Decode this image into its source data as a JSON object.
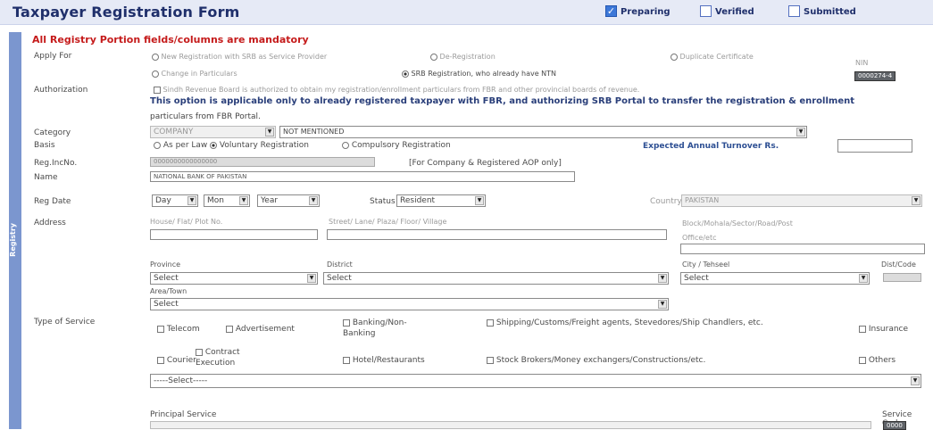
{
  "header": {
    "title": "Taxpayer Registration Form",
    "statuses": [
      {
        "label": "Preparing",
        "checked": true
      },
      {
        "label": "Verified",
        "checked": false
      },
      {
        "label": "Submitted",
        "checked": false
      }
    ]
  },
  "sidebar": {
    "label": "Registry"
  },
  "mandatory_note": "All Registry Portion fields/columns are mandatory",
  "apply_for": {
    "label": "Apply For",
    "options": [
      {
        "label": "New Registration with SRB as Service Provider",
        "selected": false
      },
      {
        "label": "De-Registration",
        "selected": false
      },
      {
        "label": "Duplicate Certificate",
        "selected": false
      },
      {
        "label": "Change in Particulars",
        "selected": false
      },
      {
        "label": "SRB Registration, who already have NTN",
        "selected": true
      }
    ],
    "nin_label": "NIN",
    "nin_value": "0000274-4"
  },
  "authorization": {
    "label": "Authorization",
    "checkbox_text": "Sindh Revenue Board is authorized to obtain my registration/enrollment particulars from FBR and other provincial boards of revenue.",
    "info_line1": "This option is applicable only to already registered taxpayer with FBR, and authorizing SRB Portal to transfer the registration & enrollment",
    "info_line2": "particulars from FBR Portal."
  },
  "category": {
    "label": "Category",
    "value": "COMPANY",
    "sub_value": "NOT MENTIONED"
  },
  "basis": {
    "label": "Basis",
    "options": [
      {
        "label": "As per Law",
        "selected": false
      },
      {
        "label": "Voluntary Registration",
        "selected": true
      },
      {
        "label": "Compulsory Registration",
        "selected": false
      }
    ],
    "turnover_label": "Expected Annual Turnover Rs.",
    "turnover_value": ""
  },
  "reg_inc": {
    "label": "Reg.IncNo.",
    "value": "0000000000000000",
    "hint": "[For Company & Registered AOP only]"
  },
  "name": {
    "label": "Name",
    "value": "NATIONAL BANK OF PAKISTAN"
  },
  "reg_date": {
    "label": "Reg Date",
    "day": "Day",
    "month": "Mon",
    "year": "Year",
    "status_label": "Status",
    "status_value": "Resident",
    "country_label": "Country",
    "country_value": "PAKISTAN"
  },
  "address": {
    "label": "Address",
    "house_label": "House/ Flat/ Plot No.",
    "street_label": "Street/ Lane/ Plaza/ Floor/ Village",
    "block_label": "Block/Mohala/Sector/Road/Post",
    "block_label2": "Office/etc",
    "province_label": "Province",
    "province_value": "Select",
    "district_label": "District",
    "district_value": "Select",
    "city_label": "City / Tehseel",
    "city_value": "Select",
    "distcode_label": "Dist/Code",
    "area_label": "Area/Town",
    "area_value": "Select"
  },
  "service": {
    "label": "Type of Service",
    "row1": [
      "Telecom",
      "Advertisement",
      "Banking/Non-Banking",
      "Shipping/Customs/Freight agents, Stevedores/Ship Chandlers, etc.",
      "Insurance"
    ],
    "row2": [
      "Courier",
      "Contract Execution",
      "Hotel/Restaurants",
      "Stock Brokers/Money exchangers/Constructions/etc.",
      "Others"
    ],
    "select_value": "-----Select-----",
    "principal_label": "Principal Service",
    "service_code_label": "Service Code",
    "service_code_value": "0000"
  },
  "colors": {
    "accent": "#1f2f6b",
    "sidebar": "#7b96cf",
    "mandatory": "#c51b1b"
  }
}
